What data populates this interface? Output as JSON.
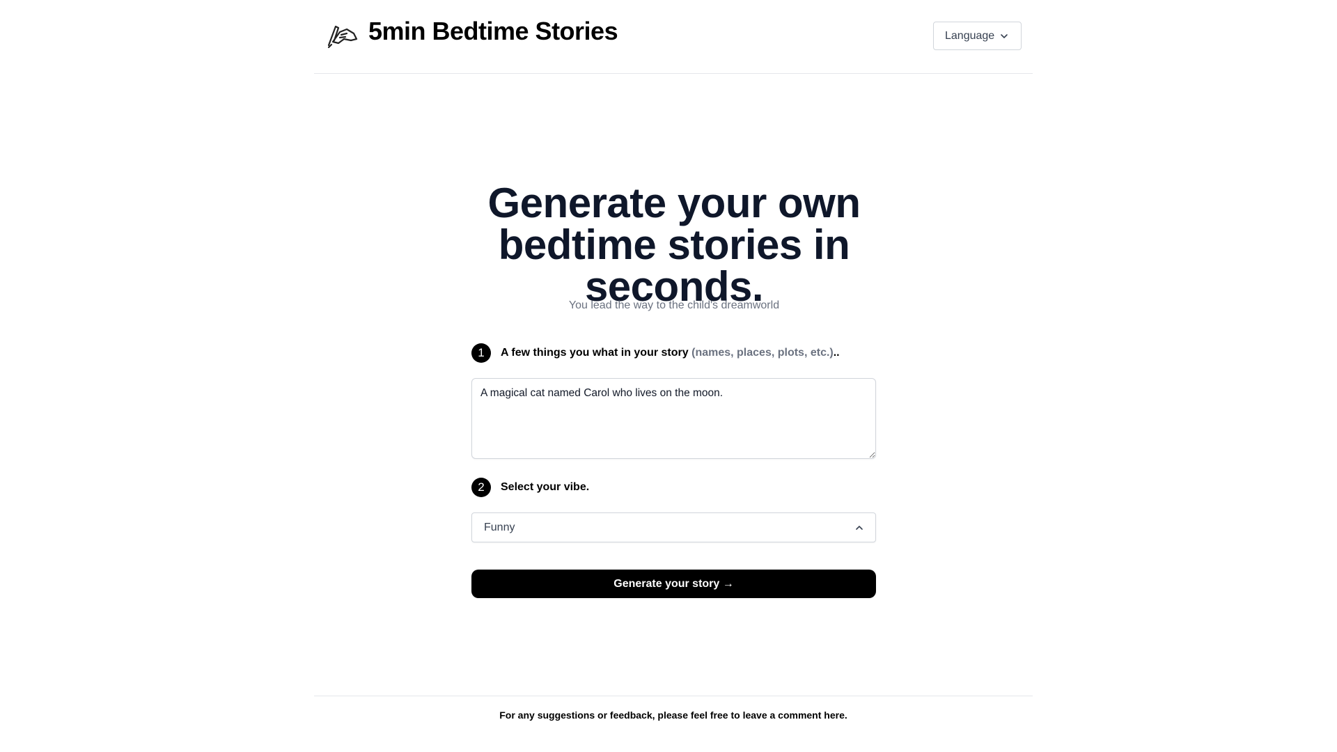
{
  "header": {
    "logo_icon": "writing-hand-icon",
    "title": "5min Bedtime Stories",
    "language_label": "Language",
    "language_icon": "chevron-down-icon"
  },
  "hero": {
    "title_line1": "Generate your own",
    "title_line2": "bedtime stories in",
    "title_line3": "seconds.",
    "subtitle": "You lead the way to the child's dreamworld"
  },
  "step1": {
    "number": "1",
    "label": "A few things you what in your story",
    "hint": "(names, places, plots, etc.)",
    "suffix": "..",
    "textarea_value": "A magical cat named Carol who lives on the moon."
  },
  "step2": {
    "number": "2",
    "label": "Select your vibe.",
    "selected_value": "Funny",
    "select_icon": "chevron-up-icon"
  },
  "generate_button": {
    "label": "Generate your story →"
  },
  "footer": {
    "text_before": "For any suggestions or feedback, please feel free to leave a comment ",
    "link_text": "here",
    "text_after": "."
  },
  "colors": {
    "primary": "#000000",
    "heading": "#0f172a",
    "muted": "#6b7280",
    "border": "#d1d5db"
  }
}
